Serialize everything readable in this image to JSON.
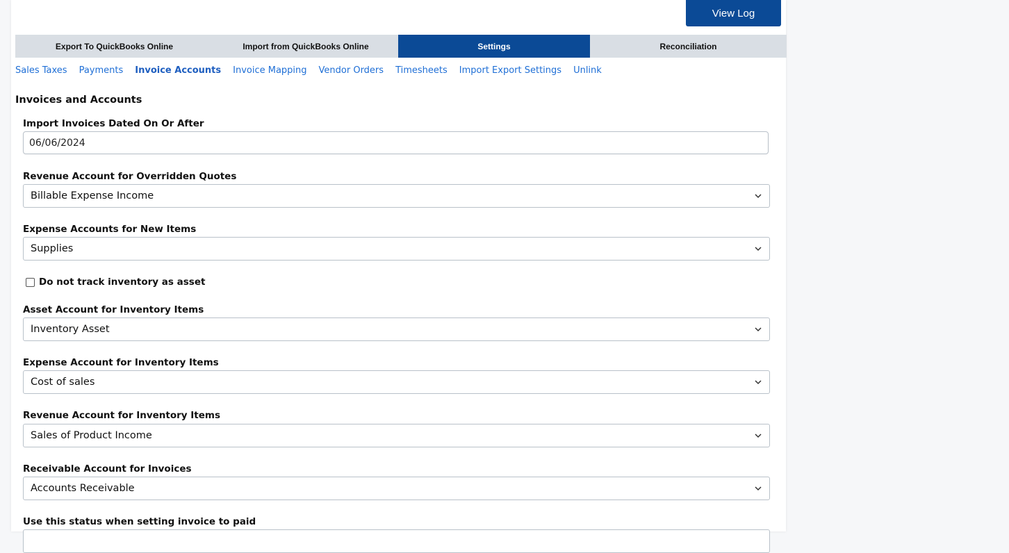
{
  "header": {
    "view_log_label": "View Log"
  },
  "tabs": [
    {
      "label": "Export To QuickBooks Online"
    },
    {
      "label": "Import from QuickBooks Online"
    },
    {
      "label": "Settings",
      "active": true
    },
    {
      "label": "Reconciliation"
    }
  ],
  "subnav": [
    {
      "label": "Sales Taxes"
    },
    {
      "label": "Payments"
    },
    {
      "label": "Invoice Accounts",
      "active": true
    },
    {
      "label": "Invoice Mapping"
    },
    {
      "label": "Vendor Orders"
    },
    {
      "label": "Timesheets"
    },
    {
      "label": "Import Export Settings"
    },
    {
      "label": "Unlink"
    }
  ],
  "section": {
    "title": "Invoices and Accounts"
  },
  "fields": {
    "import_date": {
      "label": "Import Invoices Dated On Or After",
      "value": "06/06/2024"
    },
    "revenue_overridden": {
      "label": "Revenue Account for Overridden Quotes",
      "value": "Billable Expense Income"
    },
    "expense_new_items": {
      "label": "Expense Accounts for New Items",
      "value": "Supplies"
    },
    "no_track_inventory": {
      "label": "Do not track inventory as asset",
      "checked": false
    },
    "asset_inventory": {
      "label": "Asset Account for Inventory Items",
      "value": "Inventory Asset"
    },
    "expense_inventory": {
      "label": "Expense Account for Inventory Items",
      "value": "Cost of sales"
    },
    "revenue_inventory": {
      "label": "Revenue Account for Inventory Items",
      "value": "Sales of Product Income"
    },
    "receivable": {
      "label": "Receivable Account for Invoices",
      "value": "Accounts Receivable"
    },
    "paid_status": {
      "label": "Use this status when setting invoice to paid"
    }
  },
  "colors": {
    "primary": "#0b4a96",
    "tab_bg": "#d9dee4",
    "link": "#1f6fd6"
  }
}
